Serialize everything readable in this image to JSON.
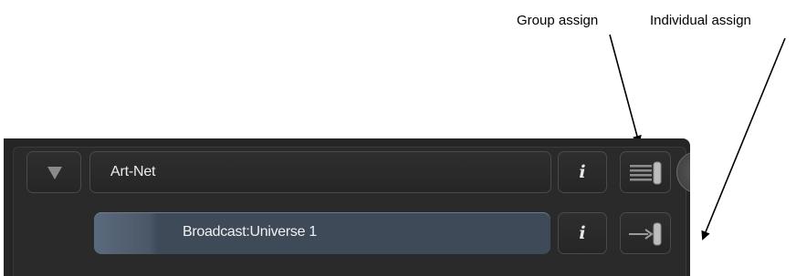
{
  "annotations": {
    "group_assign": "Group assign",
    "individual_assign": "Individual assign"
  },
  "panel": {
    "protocol_name": "Art-Net",
    "universe_label": "Broadcast:Universe 1",
    "info_glyph": "i"
  },
  "icons": {
    "expand": "triangle-down-icon",
    "info": "info-icon",
    "group_assign": "stacked-lines-handle-icon",
    "individual_assign": "arrow-to-handle-icon"
  },
  "colors": {
    "panel_bg": "#252525",
    "button_border": "#4a4a4a",
    "highlight_row": "#3f4a58",
    "text": "#ececec"
  }
}
